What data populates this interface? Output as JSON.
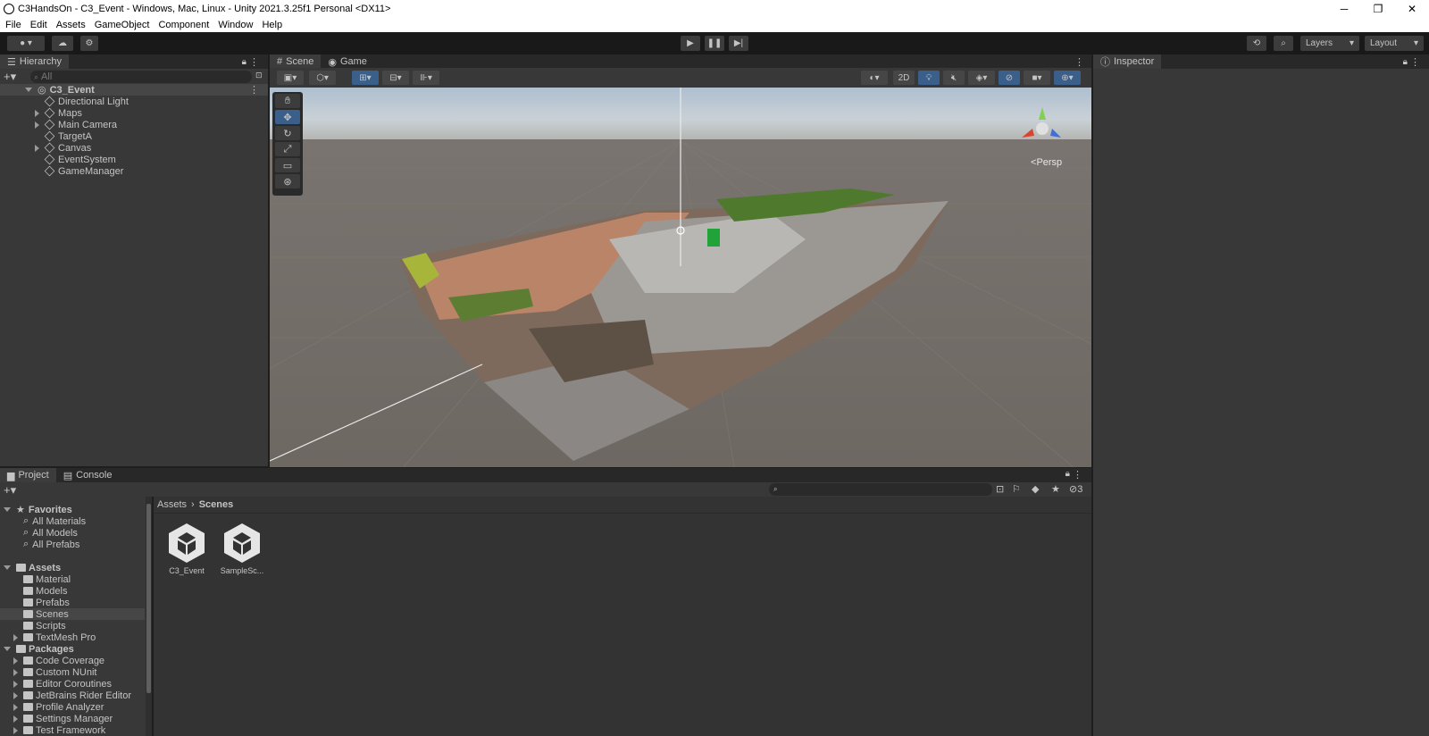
{
  "window": {
    "title": "C3HandsOn - C3_Event - Windows, Mac, Linux - Unity 2021.3.25f1 Personal <DX11>",
    "controls": [
      "─",
      "❐",
      "✕"
    ]
  },
  "menu": [
    "File",
    "Edit",
    "Assets",
    "GameObject",
    "Component",
    "Window",
    "Help"
  ],
  "toolbar": {
    "layers_label": "Layers",
    "layout_label": "Layout"
  },
  "hierarchy": {
    "tab_label": "Hierarchy",
    "search_placeholder": "All",
    "scene_name": "C3_Event",
    "items": [
      {
        "label": "Directional Light",
        "expandable": false
      },
      {
        "label": "Maps",
        "expandable": true
      },
      {
        "label": "Main Camera",
        "expandable": true
      },
      {
        "label": "TargetA",
        "expandable": false
      },
      {
        "label": "Canvas",
        "expandable": true
      },
      {
        "label": "EventSystem",
        "expandable": false
      },
      {
        "label": "GameManager",
        "expandable": false
      }
    ]
  },
  "scene_view": {
    "tabs": [
      "Scene",
      "Game"
    ],
    "mode_2d": "2D",
    "persp_label": "Persp"
  },
  "inspector": {
    "tab_label": "Inspector"
  },
  "project": {
    "tabs": [
      "Project",
      "Console"
    ],
    "hidden_count": "3",
    "breadcrumb": [
      "Assets",
      "Scenes"
    ],
    "favorites_label": "Favorites",
    "favorites": [
      "All Materials",
      "All Models",
      "All Prefabs"
    ],
    "assets_label": "Assets",
    "assets": [
      {
        "label": "Material",
        "expandable": false
      },
      {
        "label": "Models",
        "expandable": false
      },
      {
        "label": "Prefabs",
        "expandable": false
      },
      {
        "label": "Scenes",
        "expandable": false,
        "selected": true
      },
      {
        "label": "Scripts",
        "expandable": false
      },
      {
        "label": "TextMesh Pro",
        "expandable": true
      }
    ],
    "packages_label": "Packages",
    "packages": [
      "Code Coverage",
      "Custom NUnit",
      "Editor Coroutines",
      "JetBrains Rider Editor",
      "Profile Analyzer",
      "Settings Manager",
      "Test Framework"
    ],
    "files": [
      "C3_Event",
      "SampleSc..."
    ]
  },
  "colors": {
    "selection": "#2c5d87",
    "panel": "#383838",
    "accent": "#3a5f8a"
  }
}
